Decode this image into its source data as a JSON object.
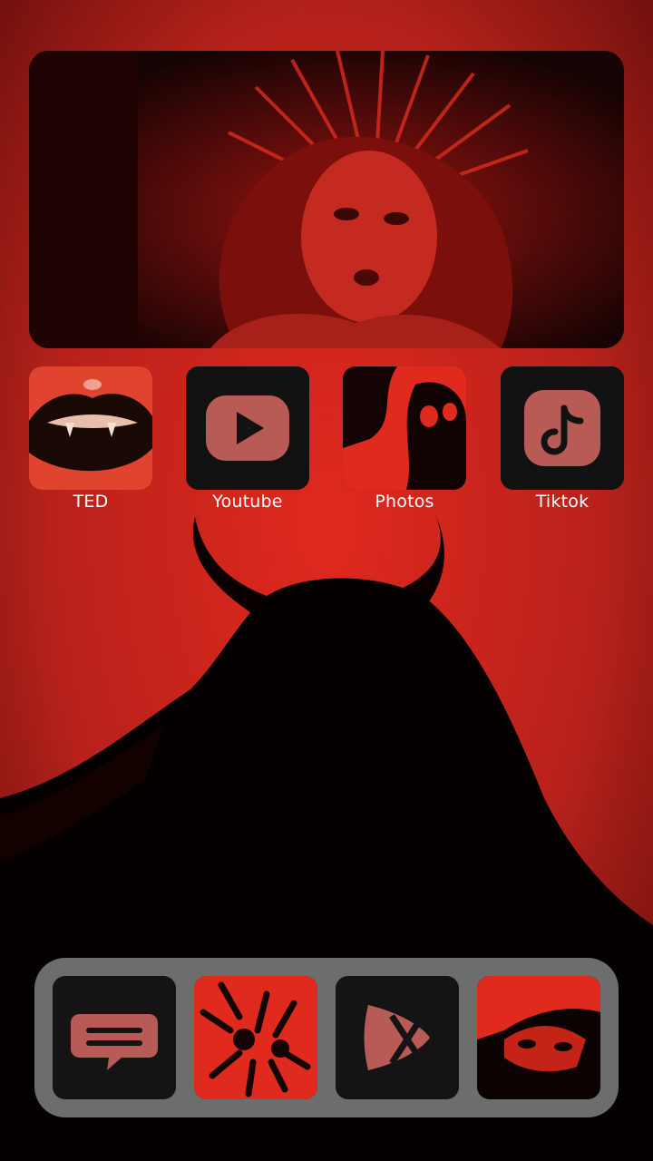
{
  "home": {
    "apps": [
      {
        "label": "TED",
        "icon": "vampire-lips-icon"
      },
      {
        "label": "Youtube",
        "icon": "youtube-play-icon"
      },
      {
        "label": "Photos",
        "icon": "skull-photo-icon"
      },
      {
        "label": "Tiktok",
        "icon": "tiktok-note-icon"
      }
    ]
  },
  "dock": {
    "apps": [
      {
        "icon": "chat-bubble-icon"
      },
      {
        "icon": "hands-photo-icon"
      },
      {
        "icon": "play-x-icon"
      },
      {
        "icon": "face-photo-icon"
      }
    ]
  },
  "colors": {
    "wallpaper_red": "#b4221c",
    "accent_red": "#e02a20",
    "tile_dark": "#121212",
    "dock_gray": "#808080",
    "label_white": "#ffffff"
  }
}
